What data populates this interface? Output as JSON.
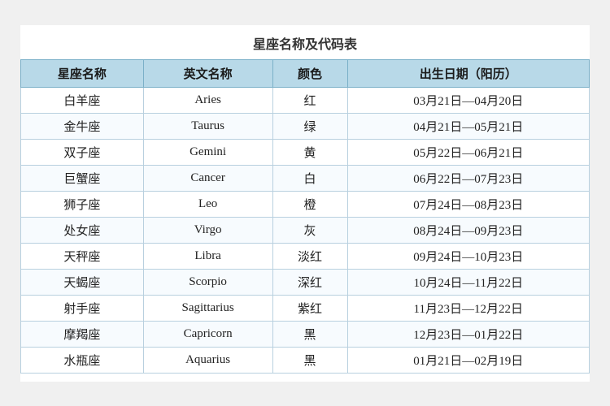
{
  "title": "星座名称及代码表",
  "headers": [
    "星座名称",
    "英文名称",
    "颜色",
    "出生日期（阳历）"
  ],
  "rows": [
    {
      "chinese": "白羊座",
      "english": "Aries",
      "color": "红",
      "date": "03月21日—04月20日"
    },
    {
      "chinese": "金牛座",
      "english": "Taurus",
      "color": "绿",
      "date": "04月21日—05月21日"
    },
    {
      "chinese": "双子座",
      "english": "Gemini",
      "color": "黄",
      "date": "05月22日—06月21日"
    },
    {
      "chinese": "巨蟹座",
      "english": "Cancer",
      "color": "白",
      "date": "06月22日—07月23日"
    },
    {
      "chinese": "狮子座",
      "english": "Leo",
      "color": "橙",
      "date": "07月24日—08月23日"
    },
    {
      "chinese": "处女座",
      "english": "Virgo",
      "color": "灰",
      "date": "08月24日—09月23日"
    },
    {
      "chinese": "天秤座",
      "english": "Libra",
      "color": "淡红",
      "date": "09月24日—10月23日"
    },
    {
      "chinese": "天蝎座",
      "english": "Scorpio",
      "color": "深红",
      "date": "10月24日—11月22日"
    },
    {
      "chinese": "射手座",
      "english": "Sagittarius",
      "color": "紫红",
      "date": "11月23日—12月22日"
    },
    {
      "chinese": "摩羯座",
      "english": "Capricorn",
      "color": "黑",
      "date": "12月23日—01月22日"
    },
    {
      "chinese": "水瓶座",
      "english": "Aquarius",
      "color": "黑",
      "date": "01月21日—02月19日"
    }
  ]
}
